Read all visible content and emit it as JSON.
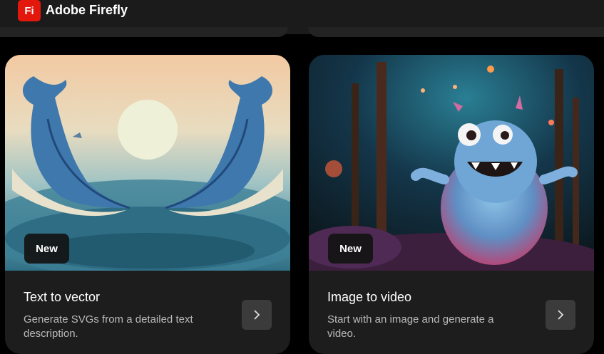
{
  "header": {
    "logo_text": "Fi",
    "app_title": "Adobe Firefly"
  },
  "cards": [
    {
      "badge": "New",
      "title": "Text to vector",
      "description": "Generate SVGs from a detailed text description.",
      "button_icon": "chevron-right-icon",
      "art": "two-whales-moon-illustration"
    },
    {
      "badge": "New",
      "title": "Image to video",
      "description": "Start with an image and generate a video.",
      "button_icon": "chevron-right-icon",
      "art": "fluffy-monster-forest-illustration"
    }
  ],
  "colors": {
    "logo_bg": "#e4170d",
    "card_bg": "#1d1d1d",
    "header_bg": "#1b1b1b",
    "button_bg": "#3b3b3b"
  }
}
